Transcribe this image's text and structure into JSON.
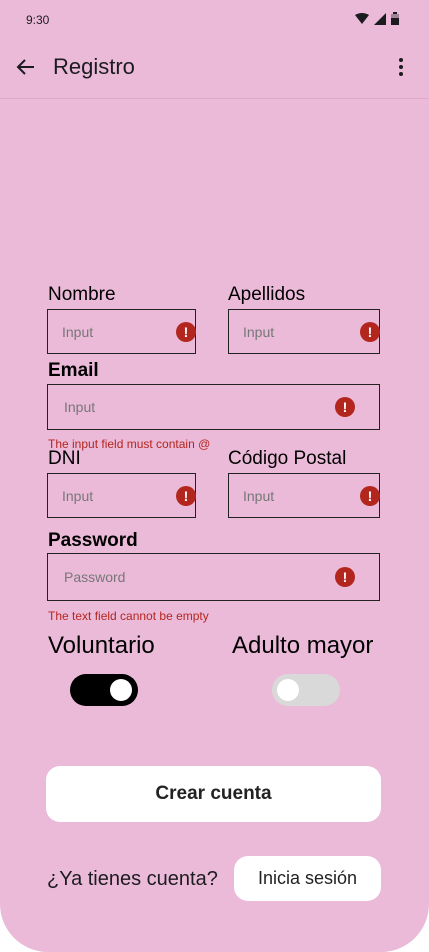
{
  "status_bar": {
    "time": "9:30"
  },
  "app_bar": {
    "title": "Registro"
  },
  "form": {
    "nombre": {
      "label": "Nombre",
      "placeholder": "Input"
    },
    "apellidos": {
      "label": "Apellidos",
      "placeholder": "Input"
    },
    "email": {
      "label": "Email",
      "placeholder": "Input",
      "error": "The input field must contain @"
    },
    "dni": {
      "label": "DNI",
      "placeholder": "Input"
    },
    "codigo_postal": {
      "label": "Código Postal",
      "placeholder": "Input"
    },
    "password": {
      "label": "Password",
      "placeholder": "Password",
      "error": "The text field cannot be empty"
    },
    "error_icon_glyph": "!"
  },
  "toggles": {
    "voluntario": {
      "label": "Voluntario",
      "on": true
    },
    "adulto_mayor": {
      "label": "Adulto mayor",
      "on": false
    }
  },
  "actions": {
    "create_label": "Crear cuenta",
    "have_account_text": "¿Ya tienes cuenta?",
    "login_label": "Inicia sesión"
  },
  "colors": {
    "background": "#ebbad9",
    "error": "#b3261e",
    "switch_on": "#000000",
    "switch_off": "#d9d9d9"
  }
}
